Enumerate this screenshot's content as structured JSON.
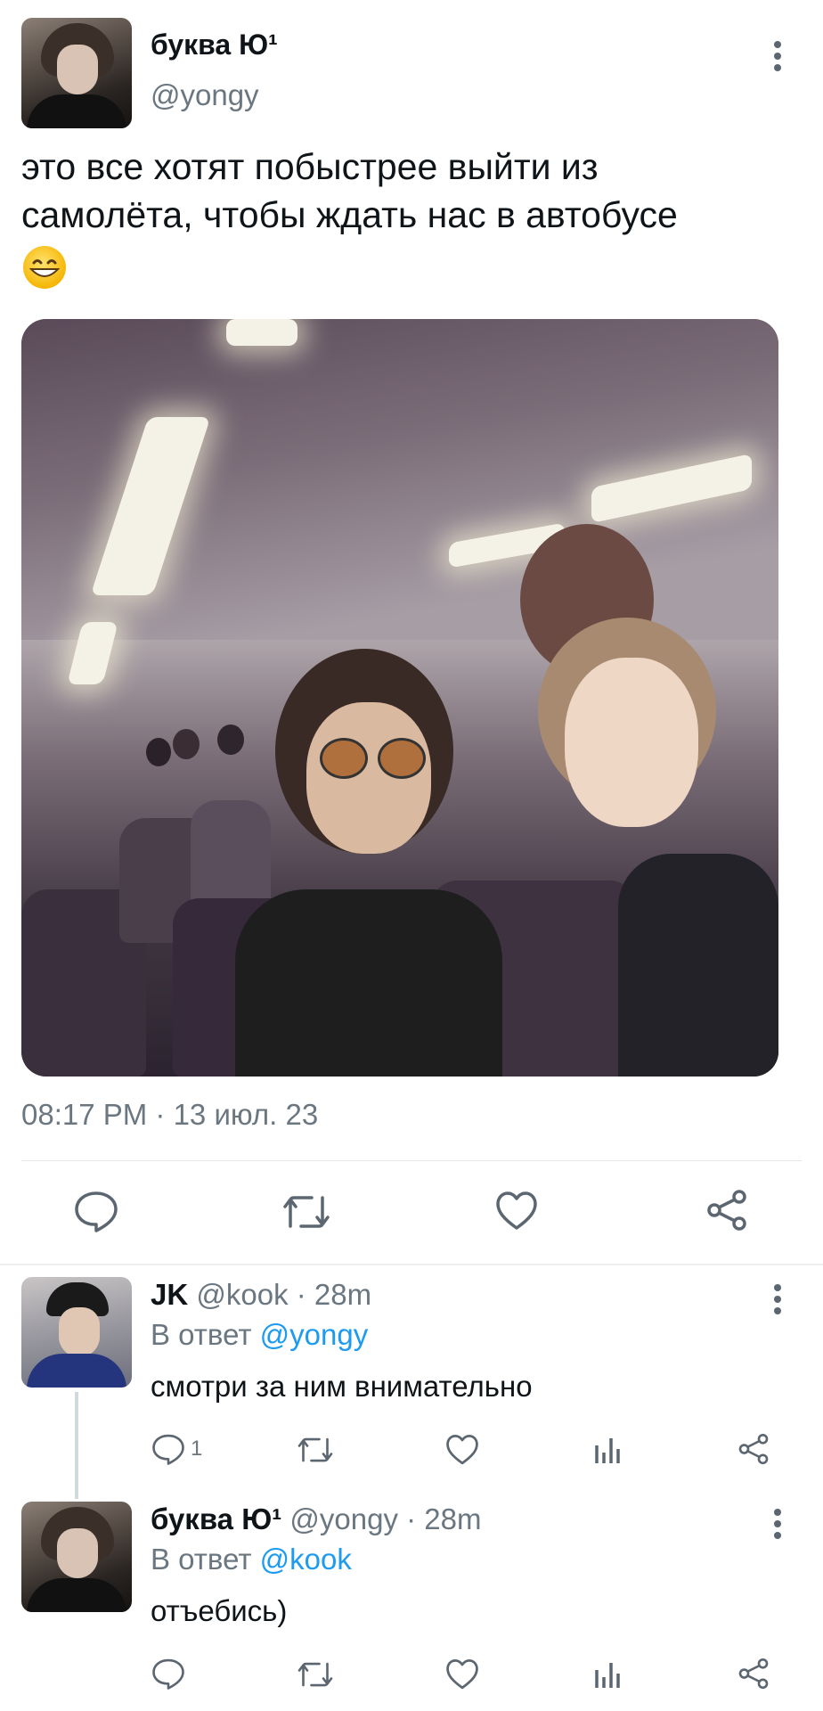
{
  "tweet": {
    "author_name": "буква Ю¹",
    "author_handle": "@yongy",
    "text_line1": "это все хотят побыстрее выйти из",
    "text_line2": "самолёта, чтобы ждать нас в автобусе",
    "emoji": "😁",
    "timestamp": "08:17 PM · 13 июл. 23",
    "actions": [
      "reply-icon",
      "retweet-icon",
      "like-icon",
      "share-icon"
    ]
  },
  "replies": [
    {
      "author_name": "JK",
      "author_handle": "@kook",
      "time": "· 28m",
      "reply_prefix": "В ответ",
      "reply_to": "@yongy",
      "text": "смотри за ним внимательно",
      "reply_count": "1"
    },
    {
      "author_name": "буква Ю¹",
      "author_handle": "@yongy",
      "time": "· 28m",
      "reply_prefix": "В ответ",
      "reply_to": "@kook",
      "text": "отъебись)"
    }
  ],
  "colors": {
    "accent": "#1d9bf0",
    "icon": "#5b6670",
    "text": "#0f1419",
    "muted": "#6b7780"
  }
}
